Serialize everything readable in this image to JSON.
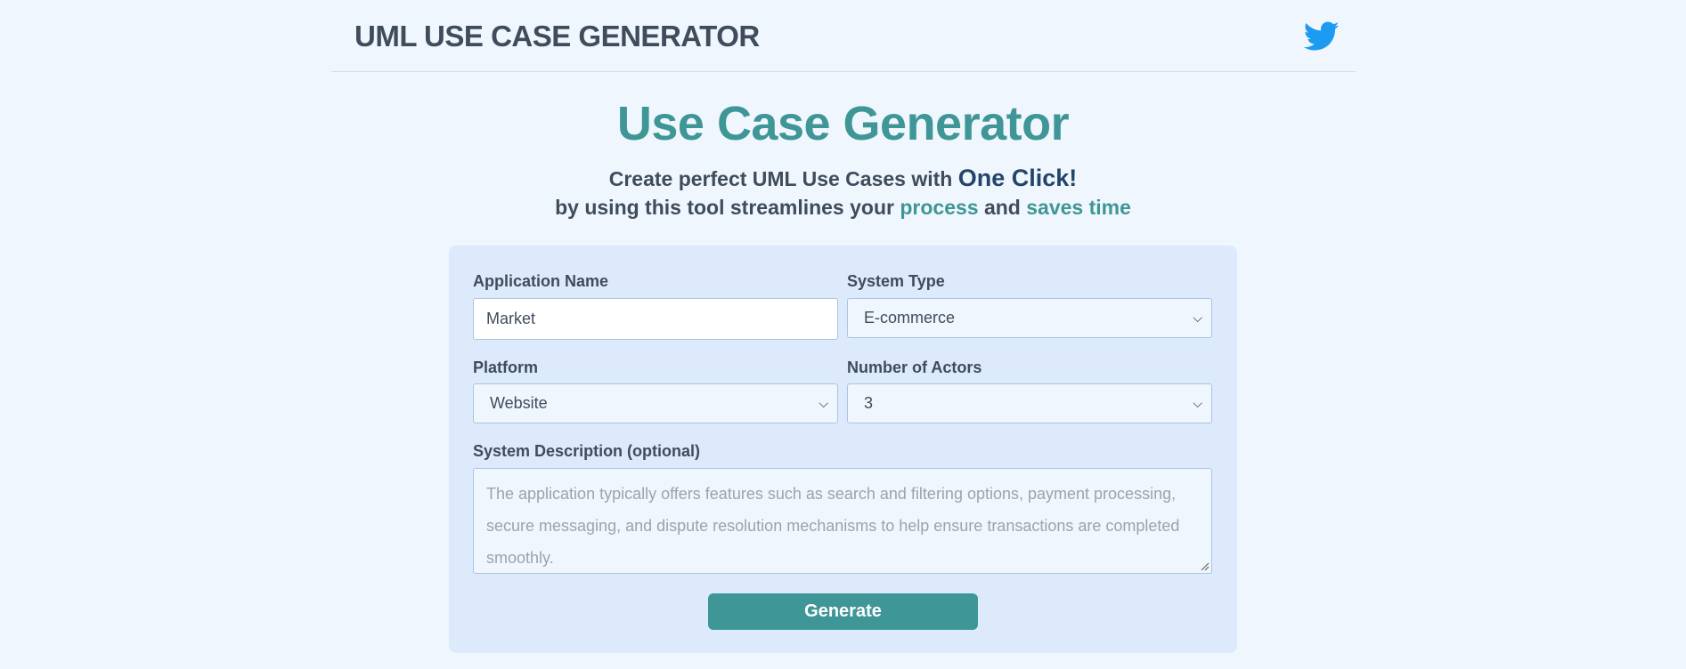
{
  "header": {
    "brand": "UML USE CASE GENERATOR",
    "social_icon": "twitter-icon",
    "accent_color": "#1d9bf0"
  },
  "hero": {
    "title": "Use Case Generator",
    "line1_prefix": "Create perfect UML Use Cases with ",
    "line1_emphasis": "One Click!",
    "line2_prefix": "by using this tool streamlines your ",
    "line2_word1": "process",
    "line2_mid": " and ",
    "line2_word2": "saves time"
  },
  "form": {
    "app_name_label": "Application Name",
    "app_name_value": "Market",
    "system_type_label": "System Type",
    "system_type_value": "E-commerce",
    "platform_label": "Platform",
    "platform_value": "Website",
    "actors_label": "Number of Actors",
    "actors_value": "3",
    "description_label": "System Description (optional)",
    "description_placeholder": "The application typically offers features such as search and filtering options, payment processing, secure messaging, and dispute resolution mechanisms to help ensure transactions are completed smoothly.",
    "generate_label": "Generate"
  },
  "colors": {
    "accent_teal": "#3f9697",
    "heading_navy": "#23456a",
    "card_bg": "#dceafc",
    "page_bg": "#f0f6fd"
  }
}
